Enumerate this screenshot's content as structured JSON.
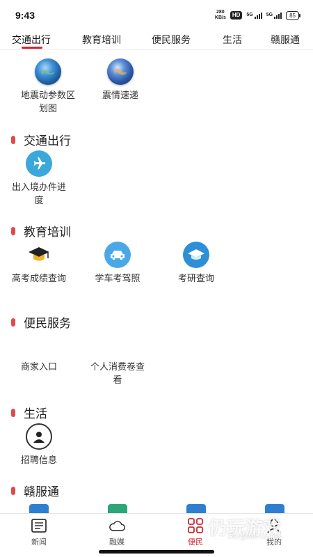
{
  "status": {
    "time": "9:43",
    "speed_top": "280",
    "speed_bottom": "KB/s",
    "hd": "HD",
    "sig1": "5G",
    "sig2": "5G",
    "battery": "85"
  },
  "tabs": [
    "交通出行",
    "教育培训",
    "便民服务",
    "生活",
    "赣服通"
  ],
  "top_items": [
    {
      "label": "地震动参数区划图",
      "icon": "globe-icon"
    },
    {
      "label": "震情速递",
      "icon": "earth-icon"
    }
  ],
  "sections": {
    "transport": {
      "title": "交通出行",
      "items": [
        {
          "label": "出入境办件进度",
          "icon": "airplane-icon"
        }
      ]
    },
    "education": {
      "title": "教育培训",
      "items": [
        {
          "label": "高考成绩查询",
          "icon": "graduation-cap-icon"
        },
        {
          "label": "学车考驾照",
          "icon": "car-icon"
        },
        {
          "label": "考研查询",
          "icon": "postgrad-cap-icon"
        }
      ]
    },
    "service": {
      "title": "便民服务",
      "items": [
        {
          "label": "商家入口"
        },
        {
          "label": "个人消费卷查看"
        }
      ]
    },
    "life": {
      "title": "生活",
      "items": [
        {
          "label": "招聘信息",
          "icon": "recruit-icon"
        }
      ]
    },
    "gft": {
      "title": "赣服通"
    }
  },
  "bottom_nav": [
    {
      "label": "新闻",
      "icon": "news-icon"
    },
    {
      "label": "融媒",
      "icon": "cloud-icon"
    },
    {
      "label": "便民",
      "icon": "grid-icon"
    },
    {
      "label": "我的",
      "icon": "person-icon"
    }
  ],
  "watermark": {
    "main": "仍玩游戏",
    "sub": "Rengwan Games"
  },
  "colors": {
    "accent": "#d9232d",
    "section_bar": "#e24a4a"
  }
}
